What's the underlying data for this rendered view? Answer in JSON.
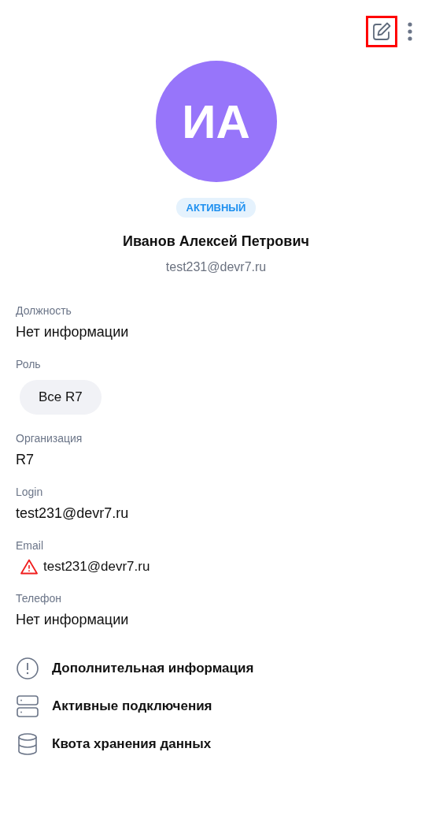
{
  "toolbar": {
    "edit_button": {
      "highlighted": true
    }
  },
  "profile": {
    "initials": "ИА",
    "status": "АКТИВНЫЙ",
    "name": "Иванов Алексей Петрович",
    "email": "test231@devr7.ru"
  },
  "fields": [
    {
      "label": "Должность",
      "value": "Нет информации",
      "kind": "text"
    },
    {
      "label": "Роль",
      "value": "Все R7",
      "kind": "chip"
    },
    {
      "label": "Организация",
      "value": "R7",
      "kind": "text"
    },
    {
      "label": "Login",
      "value": "test231@devr7.ru",
      "kind": "text"
    },
    {
      "label": "Email",
      "value": "test231@devr7.ru",
      "kind": "warning"
    },
    {
      "label": "Телефон",
      "value": "Нет информации",
      "kind": "text"
    }
  ],
  "sections": [
    {
      "label": "Дополнительная информация",
      "kind": "info"
    },
    {
      "label": "Активные подключения",
      "kind": "servers"
    },
    {
      "label": "Квота хранения данных",
      "kind": "storage"
    }
  ]
}
